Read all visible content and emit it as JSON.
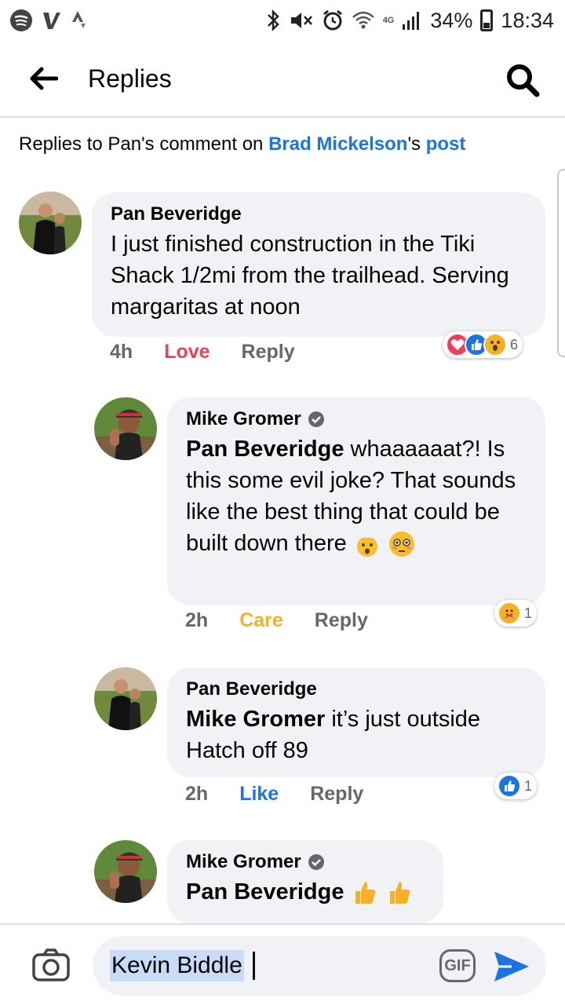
{
  "status_bar": {
    "battery": "34%",
    "time": "18:34",
    "network": "4G"
  },
  "header": {
    "title": "Replies"
  },
  "context": {
    "prefix": "Replies to Pan's comment on ",
    "author": "Brad Mickelson",
    "possessive": "'s ",
    "post": "post"
  },
  "comments": [
    {
      "author": "Pan Beveridge",
      "text": "I just finished construction in the Tiki Shack 1/2mi from the trailhead. Serving margaritas at noon",
      "time": "4h",
      "reaction_label": "Love",
      "reaction_color": "#f33e58",
      "reply_label": "Reply",
      "reactions_count": "6"
    },
    {
      "author": "Mike Gromer",
      "mention": "Pan Beveridge",
      "text": " whaaaaaat?! Is this some evil joke? That sounds like the best thing that could be built down there",
      "time": "2h",
      "reaction_label": "Care",
      "reaction_color": "#f7b125",
      "reply_label": "Reply",
      "reactions_count": "1"
    },
    {
      "author": "Pan Beveridge",
      "mention": "Mike Gromer",
      "text": " it’s just outside Hatch off 89",
      "time": "2h",
      "reaction_label": "Like",
      "reaction_color": "#1b74e4",
      "reply_label": "Reply",
      "reactions_count": "1"
    },
    {
      "author": "Mike Gromer",
      "mention": "Pan Beveridge"
    }
  ],
  "composer": {
    "value": "Kevin Biddle",
    "gif_label": "GIF"
  }
}
